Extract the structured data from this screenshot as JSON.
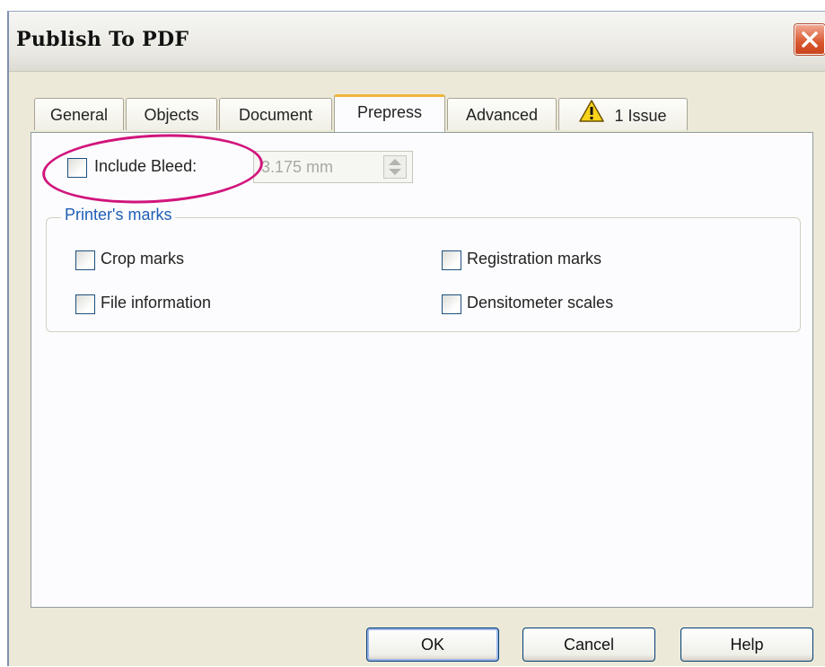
{
  "window": {
    "title": "Publish To PDF",
    "close_icon": "close-x-icon",
    "close_color": "#d9582f"
  },
  "tabs": [
    {
      "label": "General",
      "active": false
    },
    {
      "label": "Objects",
      "active": false
    },
    {
      "label": "Document",
      "active": false
    },
    {
      "label": "Prepress",
      "active": true
    },
    {
      "label": "Advanced",
      "active": false
    },
    {
      "label": "1 Issue",
      "active": false,
      "icon": "warning-icon"
    }
  ],
  "prepress": {
    "include_bleed": {
      "label": "Include Bleed:",
      "checked": false
    },
    "bleed_value": "3.175 mm",
    "bleed_disabled": true,
    "highlight_color": "#d1157c",
    "printers_marks": {
      "title": "Printer's marks",
      "crop_marks": {
        "label": "Crop marks",
        "checked": false
      },
      "file_information": {
        "label": "File information",
        "checked": false
      },
      "registration_marks": {
        "label": "Registration marks",
        "checked": false
      },
      "densitometer_scales": {
        "label": "Densitometer scales",
        "checked": false
      }
    }
  },
  "buttons": {
    "ok": "OK",
    "cancel": "Cancel",
    "help": "Help"
  }
}
